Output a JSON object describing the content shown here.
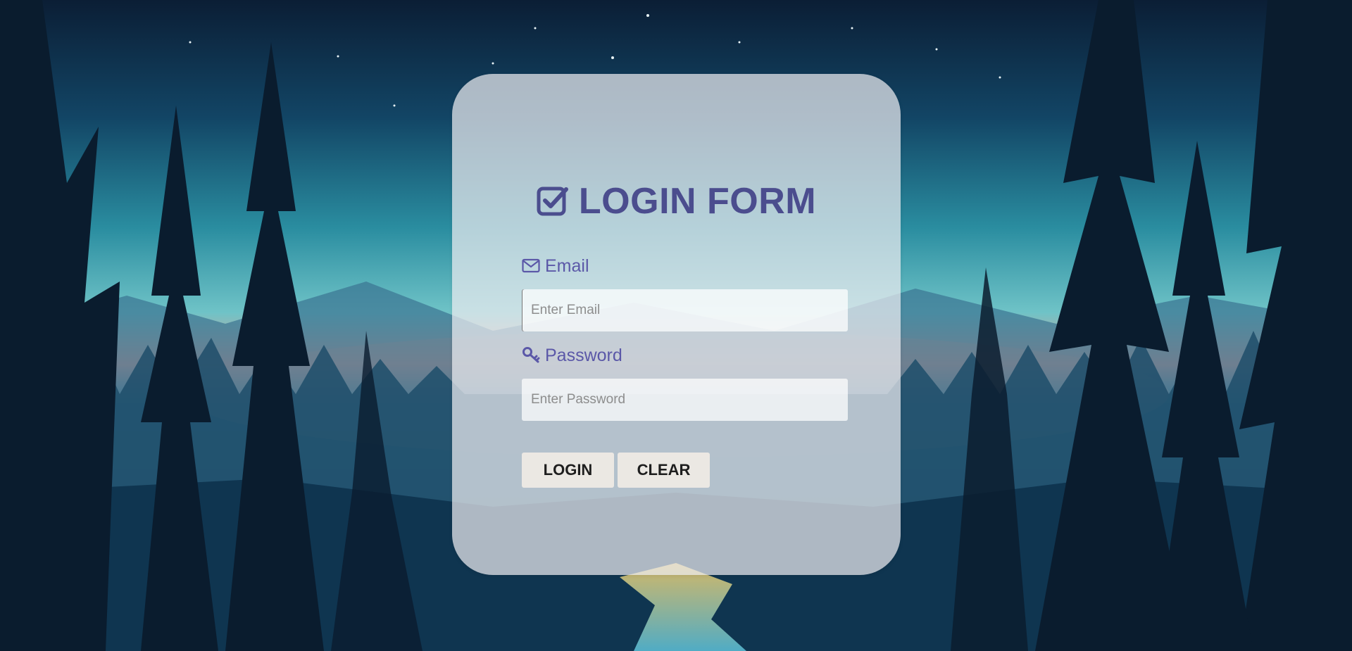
{
  "form": {
    "title": "LOGIN FORM",
    "title_icon": "check-square-icon",
    "email": {
      "label": "Email",
      "icon": "envelope-icon",
      "placeholder": "Enter Email",
      "value": ""
    },
    "password": {
      "label": "Password",
      "icon": "key-icon",
      "placeholder": "Enter Password",
      "value": ""
    },
    "buttons": {
      "login_label": "LOGIN",
      "clear_label": "CLEAR"
    }
  },
  "colors": {
    "accent": "#4b4d8e",
    "label": "#5b58a8",
    "card_bg": "#ececf0",
    "button_bg": "#f8f0e8"
  },
  "background": {
    "scene": "night forest with river"
  }
}
